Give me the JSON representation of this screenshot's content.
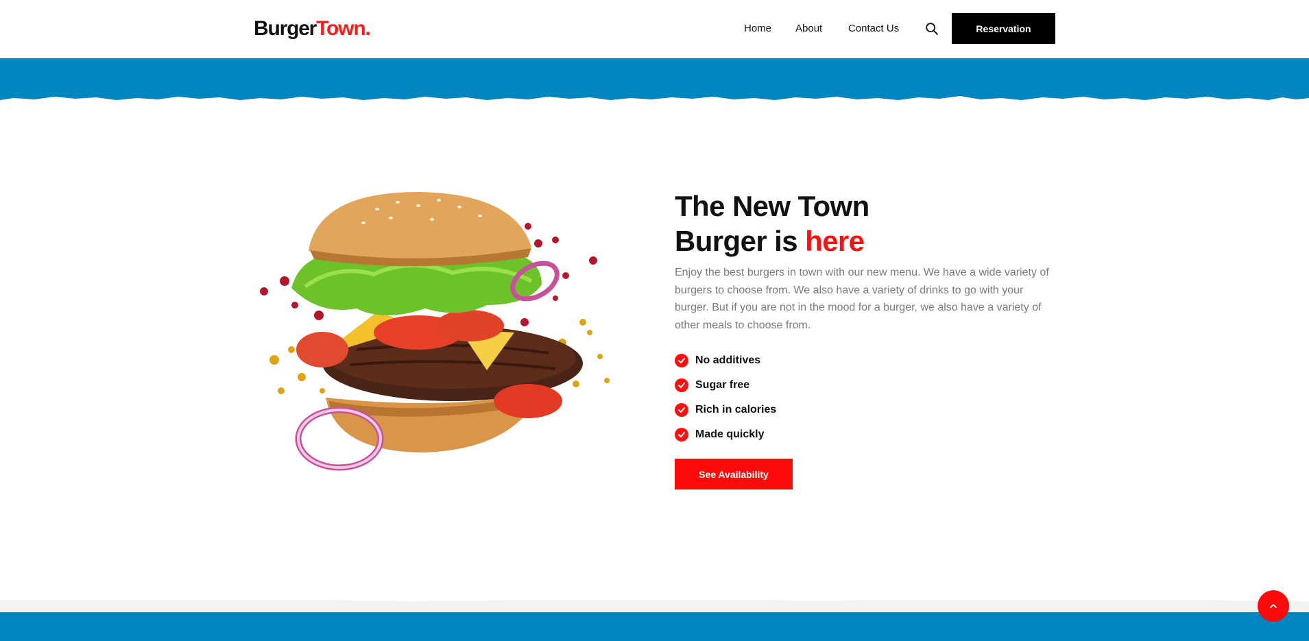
{
  "header": {
    "logo_part1": "Burger",
    "logo_part2": "Town.",
    "nav": {
      "home": "Home",
      "about": "About",
      "contact": "Contact Us"
    },
    "reservation_label": "Reservation"
  },
  "hero": {
    "title_line1": "The New Town",
    "title_line2_start": "Burger is ",
    "title_line2_highlight": "here",
    "description": "Enjoy the best burgers in town with our new menu. We have a wide variety of burgers to choose from. We also have a variety of drinks to go with your burger. But if you are not in the mood for a burger, we also have a variety of other meals to choose from.",
    "features": [
      "No additives",
      "Sugar free",
      "Rich in calories",
      "Made quickly"
    ],
    "cta_label": "See Availability"
  },
  "colors": {
    "accent": "#ff1010",
    "band_blue": "#0086bf",
    "button_dark": "#000000"
  },
  "icons": {
    "search": "search-icon",
    "check": "check-circle-icon",
    "scroll_top": "chevron-up-icon"
  }
}
